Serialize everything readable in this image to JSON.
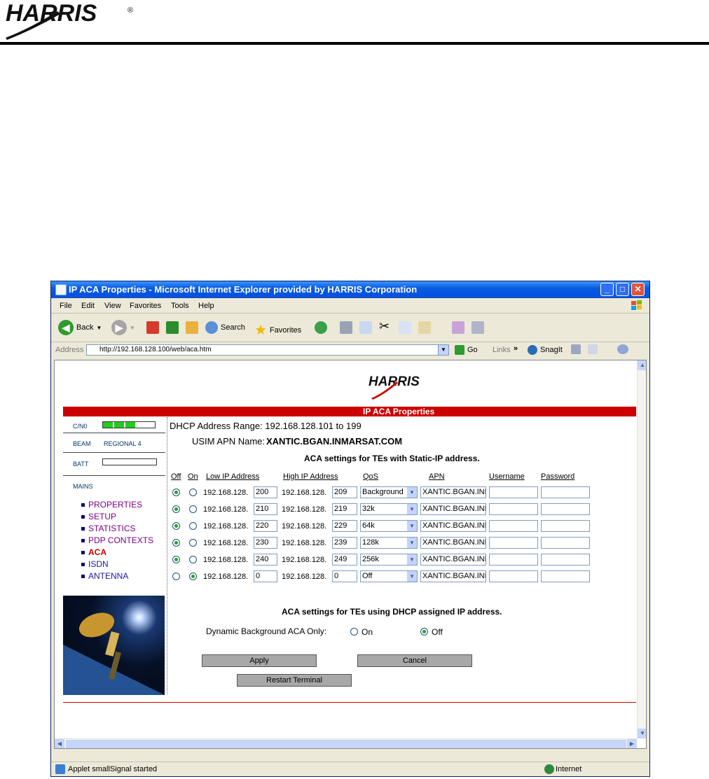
{
  "page": {
    "brand_logo_text": "HARRIS",
    "registered_mark": "®"
  },
  "window": {
    "title": "IP ACA Properties - Microsoft Internet Explorer provided by HARRIS Corporation",
    "controls": {
      "minimize": "_",
      "maximize": "□",
      "close": "✕"
    }
  },
  "menu": [
    "File",
    "Edit",
    "View",
    "Favorites",
    "Tools",
    "Help"
  ],
  "toolbar": {
    "back_label": "Back",
    "search_label": "Search",
    "favorites_label": "Favorites"
  },
  "address": {
    "label": "Address",
    "url": "http://192.168.128.100/web/aca.htm",
    "go_label": "Go",
    "links_label": "Links",
    "snagit_label": "SnagIt"
  },
  "content": {
    "logo_text": "HARRIS",
    "banner_title": "IP ACA Properties",
    "sidebar": {
      "cn0_label": "C/N0",
      "cn0_level": 0.65,
      "beam_label": "BEAM",
      "beam_value": "REGIONAL 4",
      "batt_label": "BATT",
      "mains_label": "MAINS",
      "nav": [
        {
          "label": "PROPERTIES",
          "color": "#7a0088"
        },
        {
          "label": "SETUP",
          "color": "#7a0088"
        },
        {
          "label": "STATISTICS",
          "color": "#7a0088"
        },
        {
          "label": "PDP CONTEXTS",
          "color": "#7a0088"
        },
        {
          "label": "ACA",
          "color": "#cc0000"
        },
        {
          "label": "ISDN",
          "color": "#1a1aa8"
        },
        {
          "label": "ANTENNA",
          "color": "#1a1aa8"
        }
      ]
    },
    "dhcp_range": "DHCP Address Range: 192.168.128.101 to 199",
    "usim_label": "USIM APN Name:",
    "usim_value": "XANTIC.BGAN.INMARSAT.COM",
    "static_heading": "ACA settings for TEs with Static-IP address.",
    "columns": [
      "Off",
      "On",
      "Low IP Address",
      "High IP Address",
      "QoS",
      "APN",
      "Username",
      "Password"
    ],
    "ip_prefix": "192.168.128.",
    "rows": [
      {
        "off": true,
        "low": "200",
        "high": "209",
        "qos": "Background",
        "apn": "XANTIC.BGAN.INMARSAT.COM",
        "user": "",
        "pass": ""
      },
      {
        "off": true,
        "low": "210",
        "high": "219",
        "qos": "32k",
        "apn": "XANTIC.BGAN.INMARSAT.COM",
        "user": "",
        "pass": ""
      },
      {
        "off": true,
        "low": "220",
        "high": "229",
        "qos": "64k",
        "apn": "XANTIC.BGAN.INMARSAT.COM",
        "user": "",
        "pass": ""
      },
      {
        "off": true,
        "low": "230",
        "high": "239",
        "qos": "128k",
        "apn": "XANTIC.BGAN.INMARSAT.COM",
        "user": "",
        "pass": ""
      },
      {
        "off": true,
        "low": "240",
        "high": "249",
        "qos": "256k",
        "apn": "XANTIC.BGAN.INMARSAT.COM",
        "user": "",
        "pass": ""
      },
      {
        "off": false,
        "low": "0",
        "high": "0",
        "qos": "Off",
        "apn": "XANTIC.BGAN.INMARSAT.COM",
        "user": "",
        "pass": ""
      }
    ],
    "dhcp_heading": "ACA settings for TEs using DHCP assigned IP address.",
    "dynamic_label": "Dynamic Background ACA Only:",
    "dynamic_on_label": "On",
    "dynamic_off_label": "Off",
    "dynamic_selected": "Off",
    "apply_label": "Apply",
    "cancel_label": "Cancel",
    "restart_label": "Restart Terminal"
  },
  "status": {
    "text": "Applet smallSignal started",
    "zone": "Internet"
  }
}
